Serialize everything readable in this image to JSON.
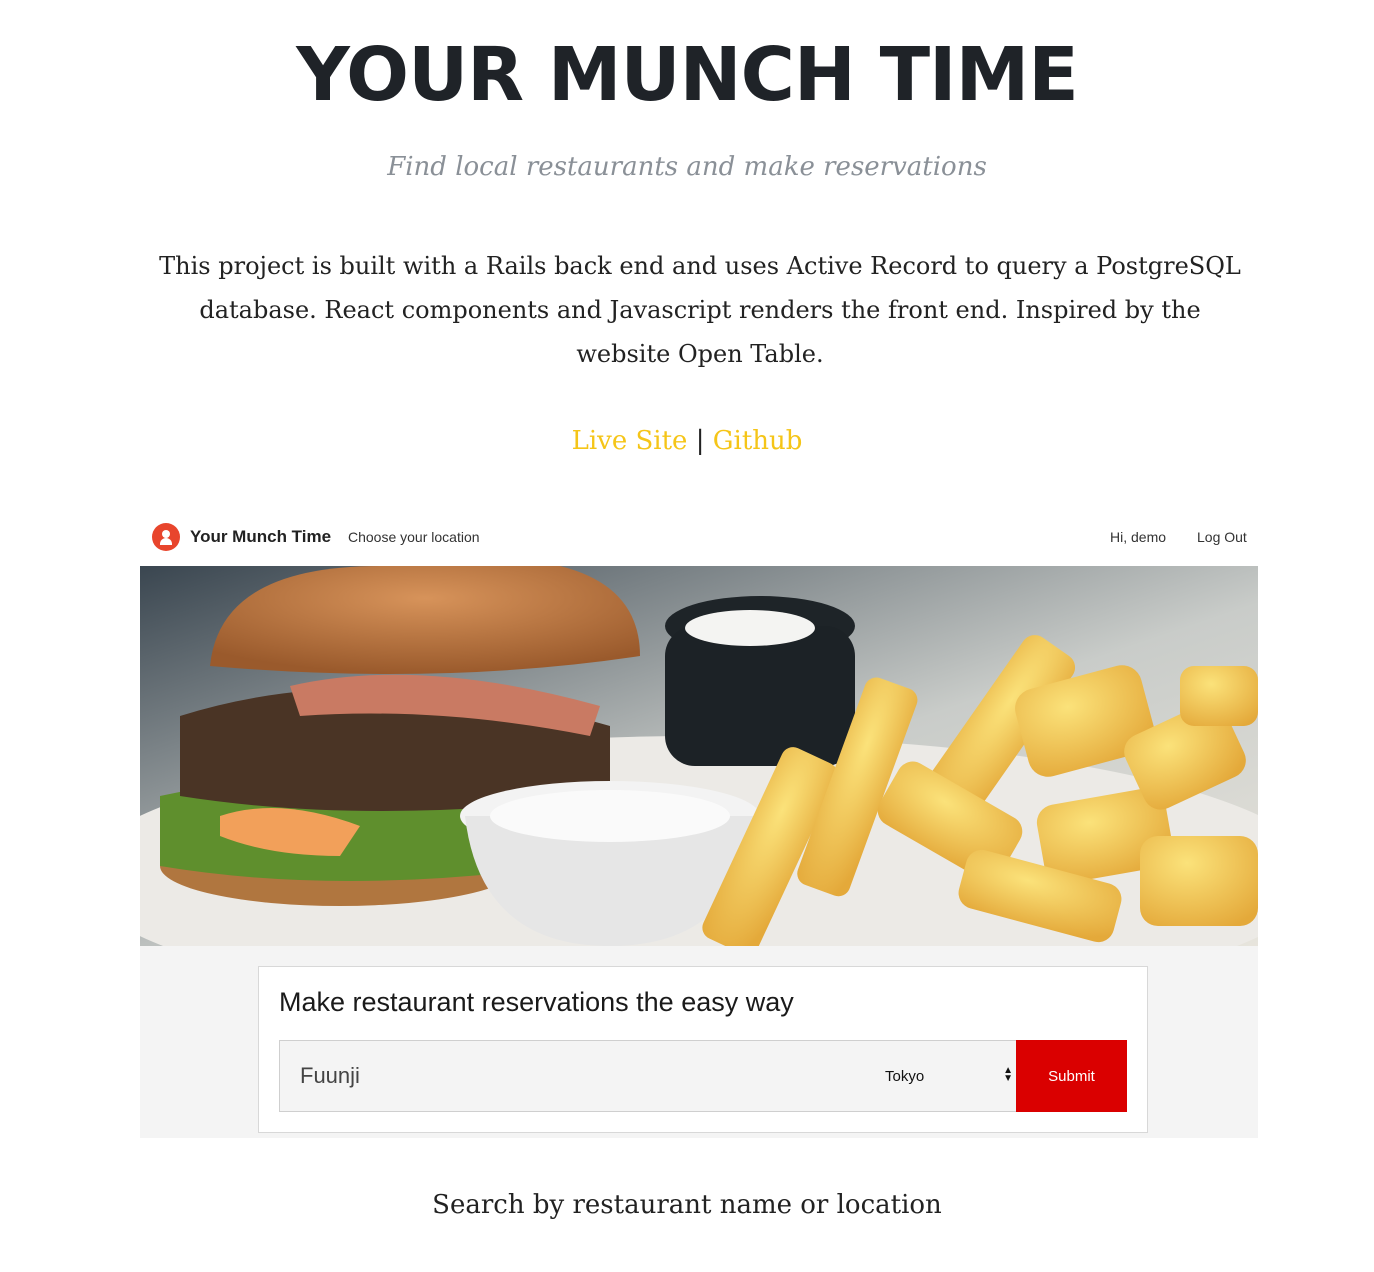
{
  "header": {
    "title": "YOUR MUNCH TIME",
    "subtitle": "Find local restaurants and make reservations",
    "description": "This project is built with a Rails back end and uses Active Record to query a PostgreSQL database. React components and Javascript renders the front end. Inspired by the website Open Table."
  },
  "links": {
    "live_site": "Live Site",
    "separator": "|",
    "github": "Github"
  },
  "colors": {
    "link": "#f5c518",
    "brand_red": "#da0000",
    "logo": "#e8452c"
  },
  "screenshot": {
    "nav": {
      "logo_icon": "person-pin-icon",
      "brand": "Your Munch Time",
      "location_link": "Choose your location",
      "greeting": "Hi, demo",
      "logout": "Log Out"
    },
    "hero_image": "burger-and-fries-photo",
    "search": {
      "heading": "Make restaurant reservations the easy way",
      "query_value": "Fuunji",
      "location_selected": "Tokyo",
      "submit_label": "Submit"
    }
  },
  "caption": "Search by restaurant name or location"
}
